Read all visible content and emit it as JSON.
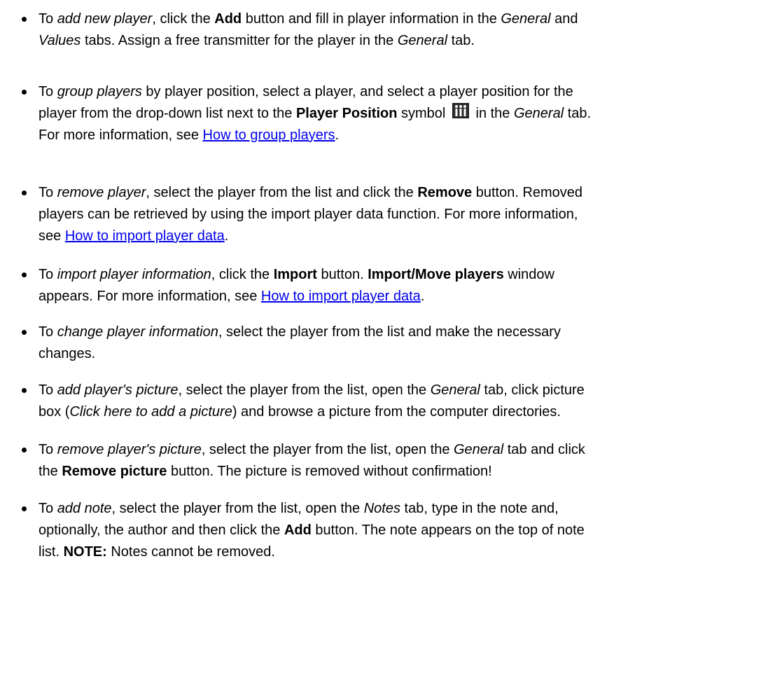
{
  "items": [
    {
      "segments": [
        {
          "t": "To "
        },
        {
          "t": "add new player",
          "s": "em"
        },
        {
          "t": ", click the "
        },
        {
          "t": "Add",
          "s": "strong"
        },
        {
          "t": " button and fill in player information in the "
        },
        {
          "t": "General",
          "s": "em"
        },
        {
          "t": " and"
        },
        {
          "br": true
        },
        {
          "t": "Values",
          "s": "em"
        },
        {
          "t": " tabs. Assign a free transmitter for the player in the "
        },
        {
          "t": "General",
          "s": "em"
        },
        {
          "t": " tab."
        }
      ]
    },
    {
      "segments": [
        {
          "t": "To "
        },
        {
          "t": "group players",
          "s": "em"
        },
        {
          "t": " by player position, select a player, and select a player position for the"
        },
        {
          "br": true
        },
        {
          "t": "player from the drop-down list next to the "
        },
        {
          "t": "Player Position",
          "s": "strong"
        },
        {
          "t": " symbol "
        },
        {
          "icon": "player-position-icon"
        },
        {
          "t": " in the "
        },
        {
          "t": "General",
          "s": "em"
        },
        {
          "t": " tab."
        },
        {
          "br": true
        },
        {
          "t": "For more information, see "
        },
        {
          "t": "How to group players",
          "s": "link"
        },
        {
          "t": "."
        }
      ]
    },
    {
      "segments": [
        {
          "t": "To "
        },
        {
          "t": "remove player",
          "s": "em"
        },
        {
          "t": ", select the player from the list and click the "
        },
        {
          "t": "Remove",
          "s": "strong"
        },
        {
          "t": " button. Removed"
        },
        {
          "br": true
        },
        {
          "t": "players can be retrieved by using the import player data function. For more information,"
        },
        {
          "br": true
        },
        {
          "t": "see "
        },
        {
          "t": "How to import player data",
          "s": "link"
        },
        {
          "t": "."
        }
      ]
    },
    {
      "segments": [
        {
          "t": "To "
        },
        {
          "t": "import player information",
          "s": "em"
        },
        {
          "t": ", click the "
        },
        {
          "t": "Import",
          "s": "strong"
        },
        {
          "t": " button. "
        },
        {
          "t": "Import/Move players",
          "s": "strong"
        },
        {
          "t": " window"
        },
        {
          "br": true
        },
        {
          "t": "appears. For more information, see "
        },
        {
          "t": "How to import player data",
          "s": "link"
        },
        {
          "t": "."
        }
      ]
    },
    {
      "segments": [
        {
          "t": "To "
        },
        {
          "t": "change player information",
          "s": "em"
        },
        {
          "t": ", select the player from the list and make the necessary"
        },
        {
          "br": true
        },
        {
          "t": "changes."
        }
      ]
    },
    {
      "segments": [
        {
          "t": "To "
        },
        {
          "t": "add player's picture",
          "s": "em"
        },
        {
          "t": ", select the player from the list, open the "
        },
        {
          "t": "General",
          "s": "em"
        },
        {
          "t": " tab, click picture"
        },
        {
          "br": true
        },
        {
          "t": "box ("
        },
        {
          "t": "Click here to add a picture",
          "s": "em"
        },
        {
          "t": ") and browse a picture from the computer directories."
        }
      ]
    },
    {
      "segments": [
        {
          "t": "To "
        },
        {
          "t": "remove player's picture",
          "s": "em"
        },
        {
          "t": ", select the player from the list, open the "
        },
        {
          "t": "General",
          "s": "em"
        },
        {
          "t": " tab and click"
        },
        {
          "br": true
        },
        {
          "t": "the "
        },
        {
          "t": "Remove picture",
          "s": "strong"
        },
        {
          "t": " button. The picture is removed without confirmation!"
        }
      ]
    },
    {
      "segments": [
        {
          "t": "To "
        },
        {
          "t": "add note",
          "s": "em"
        },
        {
          "t": ", select the player from the list, open the "
        },
        {
          "t": "Notes",
          "s": "em"
        },
        {
          "t": " tab, type in the note and,"
        },
        {
          "br": true
        },
        {
          "t": "optionally, the author and then click the "
        },
        {
          "t": "Add",
          "s": "strong"
        },
        {
          "t": " button. The note appears on the top of note"
        },
        {
          "br": true
        },
        {
          "t": "list. "
        },
        {
          "t": "NOTE:",
          "s": "strong"
        },
        {
          "t": " Notes cannot be removed."
        }
      ]
    }
  ]
}
